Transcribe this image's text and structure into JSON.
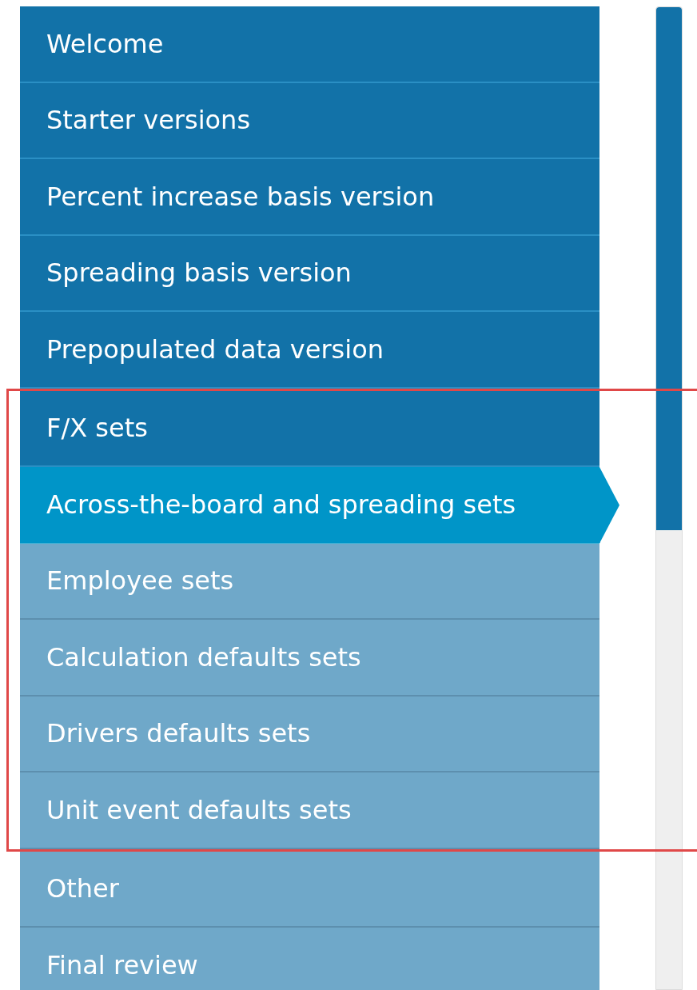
{
  "step_groups": [
    {
      "highlighted": false,
      "steps": [
        {
          "label": "Welcome",
          "completed": true,
          "selected": false
        },
        {
          "label": "Starter versions",
          "completed": true,
          "selected": false
        },
        {
          "label": "Percent increase basis version",
          "completed": true,
          "selected": false
        },
        {
          "label": "Spreading basis version",
          "completed": true,
          "selected": false
        },
        {
          "label": "Prepopulated data version",
          "completed": true,
          "selected": false
        }
      ]
    },
    {
      "highlighted": true,
      "steps": [
        {
          "label": "F/X sets",
          "completed": true,
          "selected": false
        },
        {
          "label": "Across-the-board and spreading sets",
          "selected": true
        },
        {
          "label": "Employee sets",
          "completed": false,
          "selected": false
        },
        {
          "label": "Calculation defaults sets",
          "completed": false,
          "selected": false
        },
        {
          "label": "Drivers defaults sets",
          "completed": false,
          "selected": false
        },
        {
          "label": "Unit event defaults sets",
          "completed": false,
          "selected": false
        }
      ]
    },
    {
      "highlighted": false,
      "steps": [
        {
          "label": "Other",
          "completed": false,
          "selected": false
        },
        {
          "label": "Final review",
          "completed": false,
          "selected": false
        }
      ]
    }
  ]
}
